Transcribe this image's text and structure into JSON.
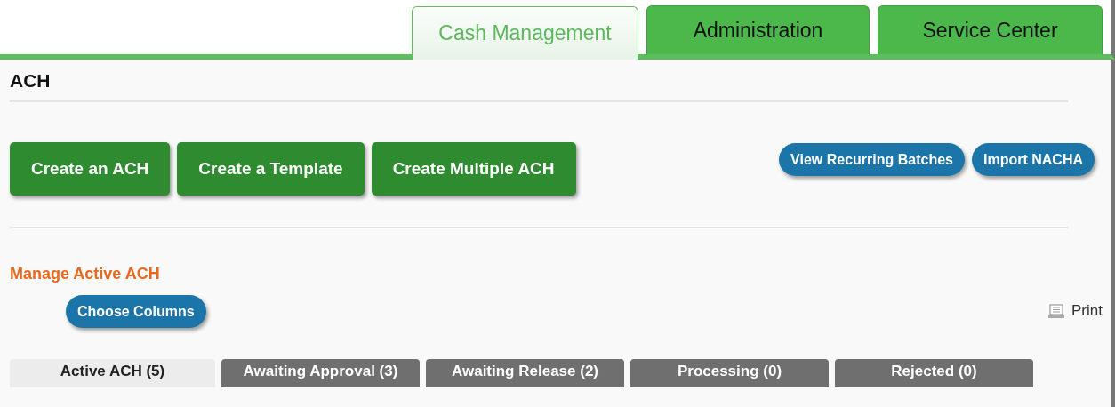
{
  "nav_tabs": [
    {
      "label": "Cash Management",
      "selected": true
    },
    {
      "label": "Administration",
      "selected": false
    },
    {
      "label": "Service Center",
      "selected": false
    }
  ],
  "page_title": "ACH",
  "primary_actions": [
    "Create an ACH",
    "Create a Template",
    "Create Multiple ACH"
  ],
  "secondary_actions": [
    "View Recurring Batches",
    "Import NACHA"
  ],
  "section_title": "Manage Active ACH",
  "choose_columns": "Choose Columns",
  "print": "Print",
  "status_tabs": [
    {
      "label": "Active ACH (5)",
      "selected": true
    },
    {
      "label": "Awaiting Approval (3)",
      "selected": false
    },
    {
      "label": "Awaiting Release (2)",
      "selected": false
    },
    {
      "label": "Processing (0)",
      "selected": false
    },
    {
      "label": "Rejected (0)",
      "selected": false
    }
  ]
}
